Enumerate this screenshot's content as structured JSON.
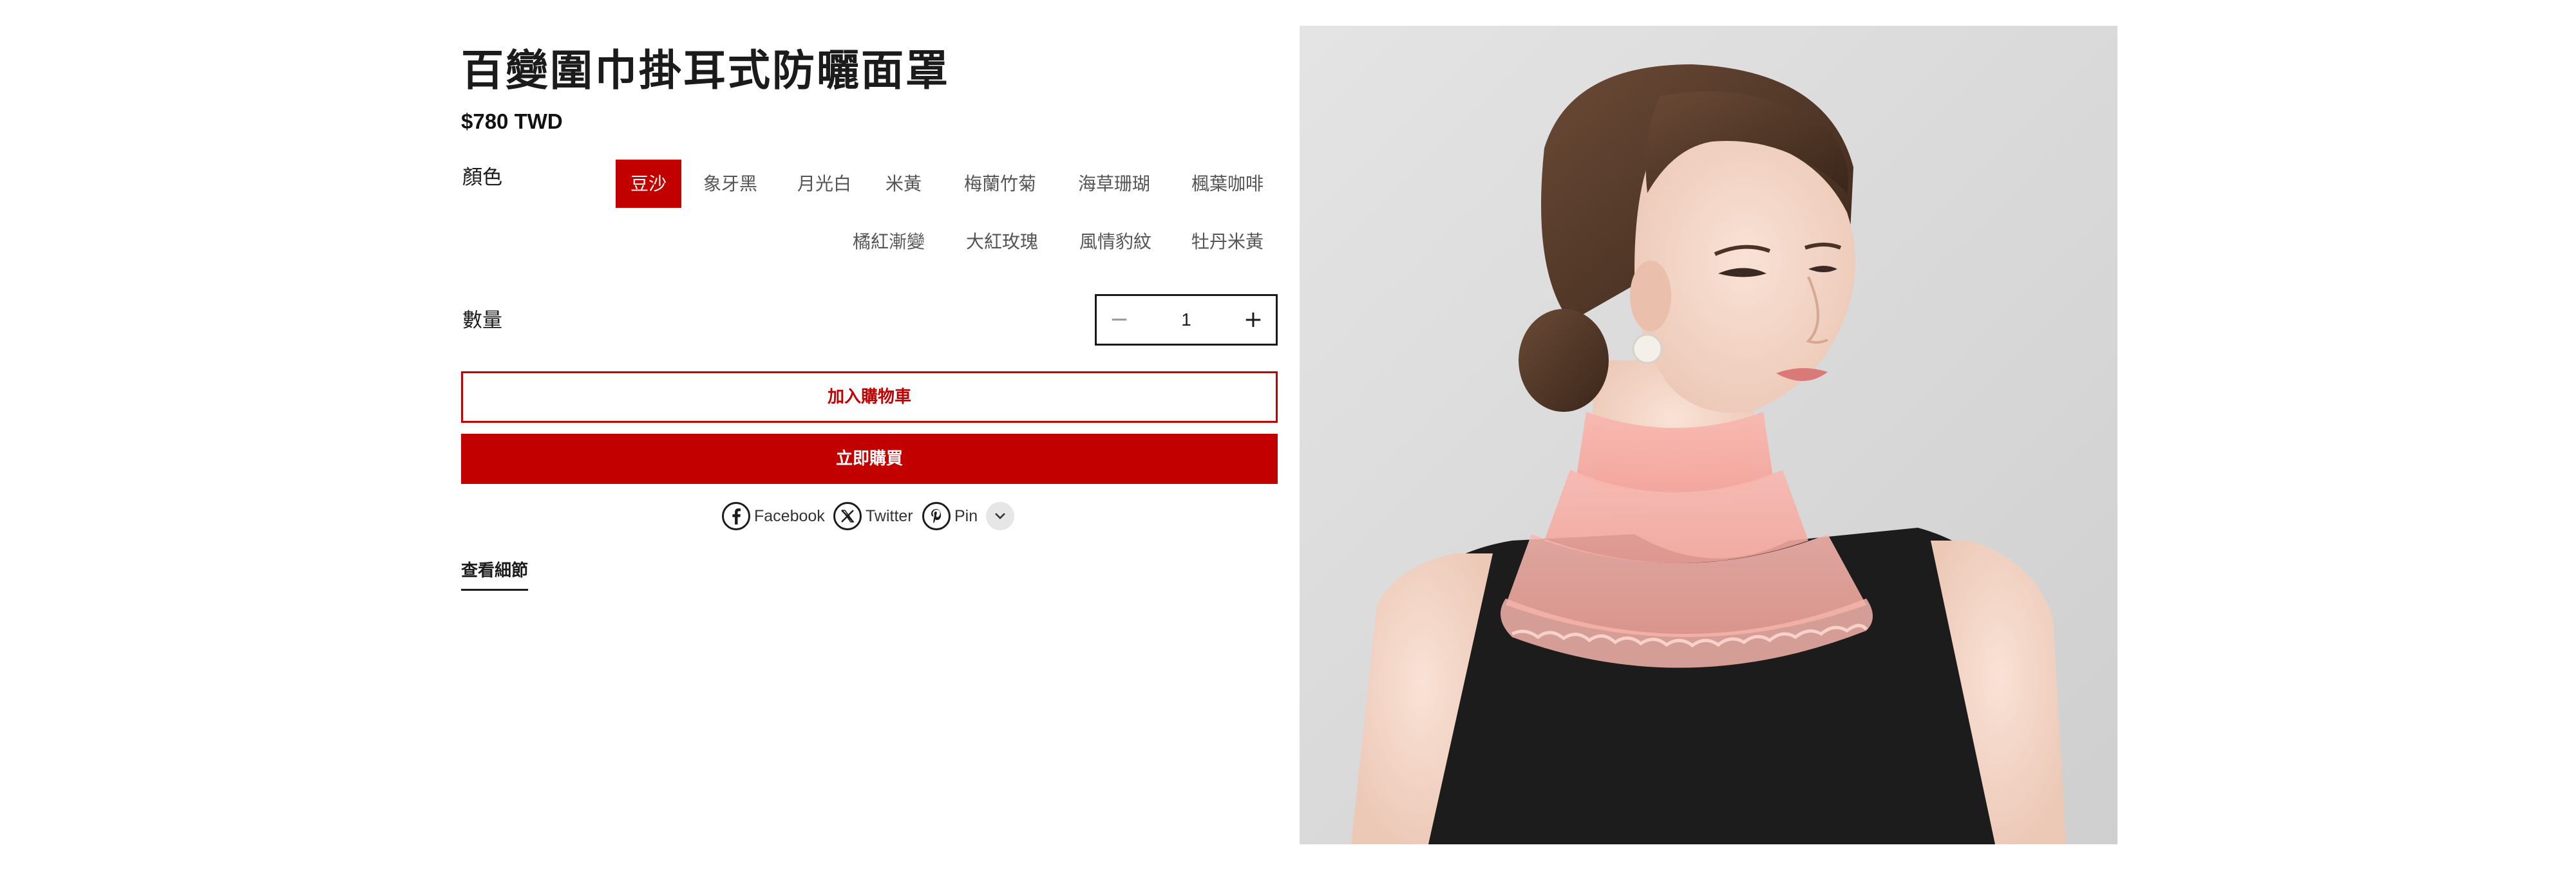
{
  "product": {
    "title": "百變圍巾掛耳式防曬面罩",
    "price": "$780 TWD"
  },
  "color": {
    "label": "顏色",
    "selected": "豆沙",
    "options": [
      "豆沙",
      "象牙黑",
      "月光白",
      "米黃",
      "梅蘭竹菊",
      "海草珊瑚",
      "楓葉咖啡",
      "橘紅漸變",
      "大紅玫瑰",
      "風情豹紋",
      "牡丹米黃"
    ]
  },
  "quantity": {
    "label": "數量",
    "value": "1",
    "minus": "−",
    "plus": "+"
  },
  "actions": {
    "add_to_cart": "加入購物車",
    "buy_now": "立即購買"
  },
  "share": {
    "facebook": "Facebook",
    "twitter": "Twitter",
    "pin": "Pin"
  },
  "details_link": "查看細節",
  "image": {
    "subject": "woman wearing pink ruffled neck scarf, black sleeveless top"
  },
  "colors": {
    "accent": "#c30000",
    "text": "#1b1b1b"
  }
}
